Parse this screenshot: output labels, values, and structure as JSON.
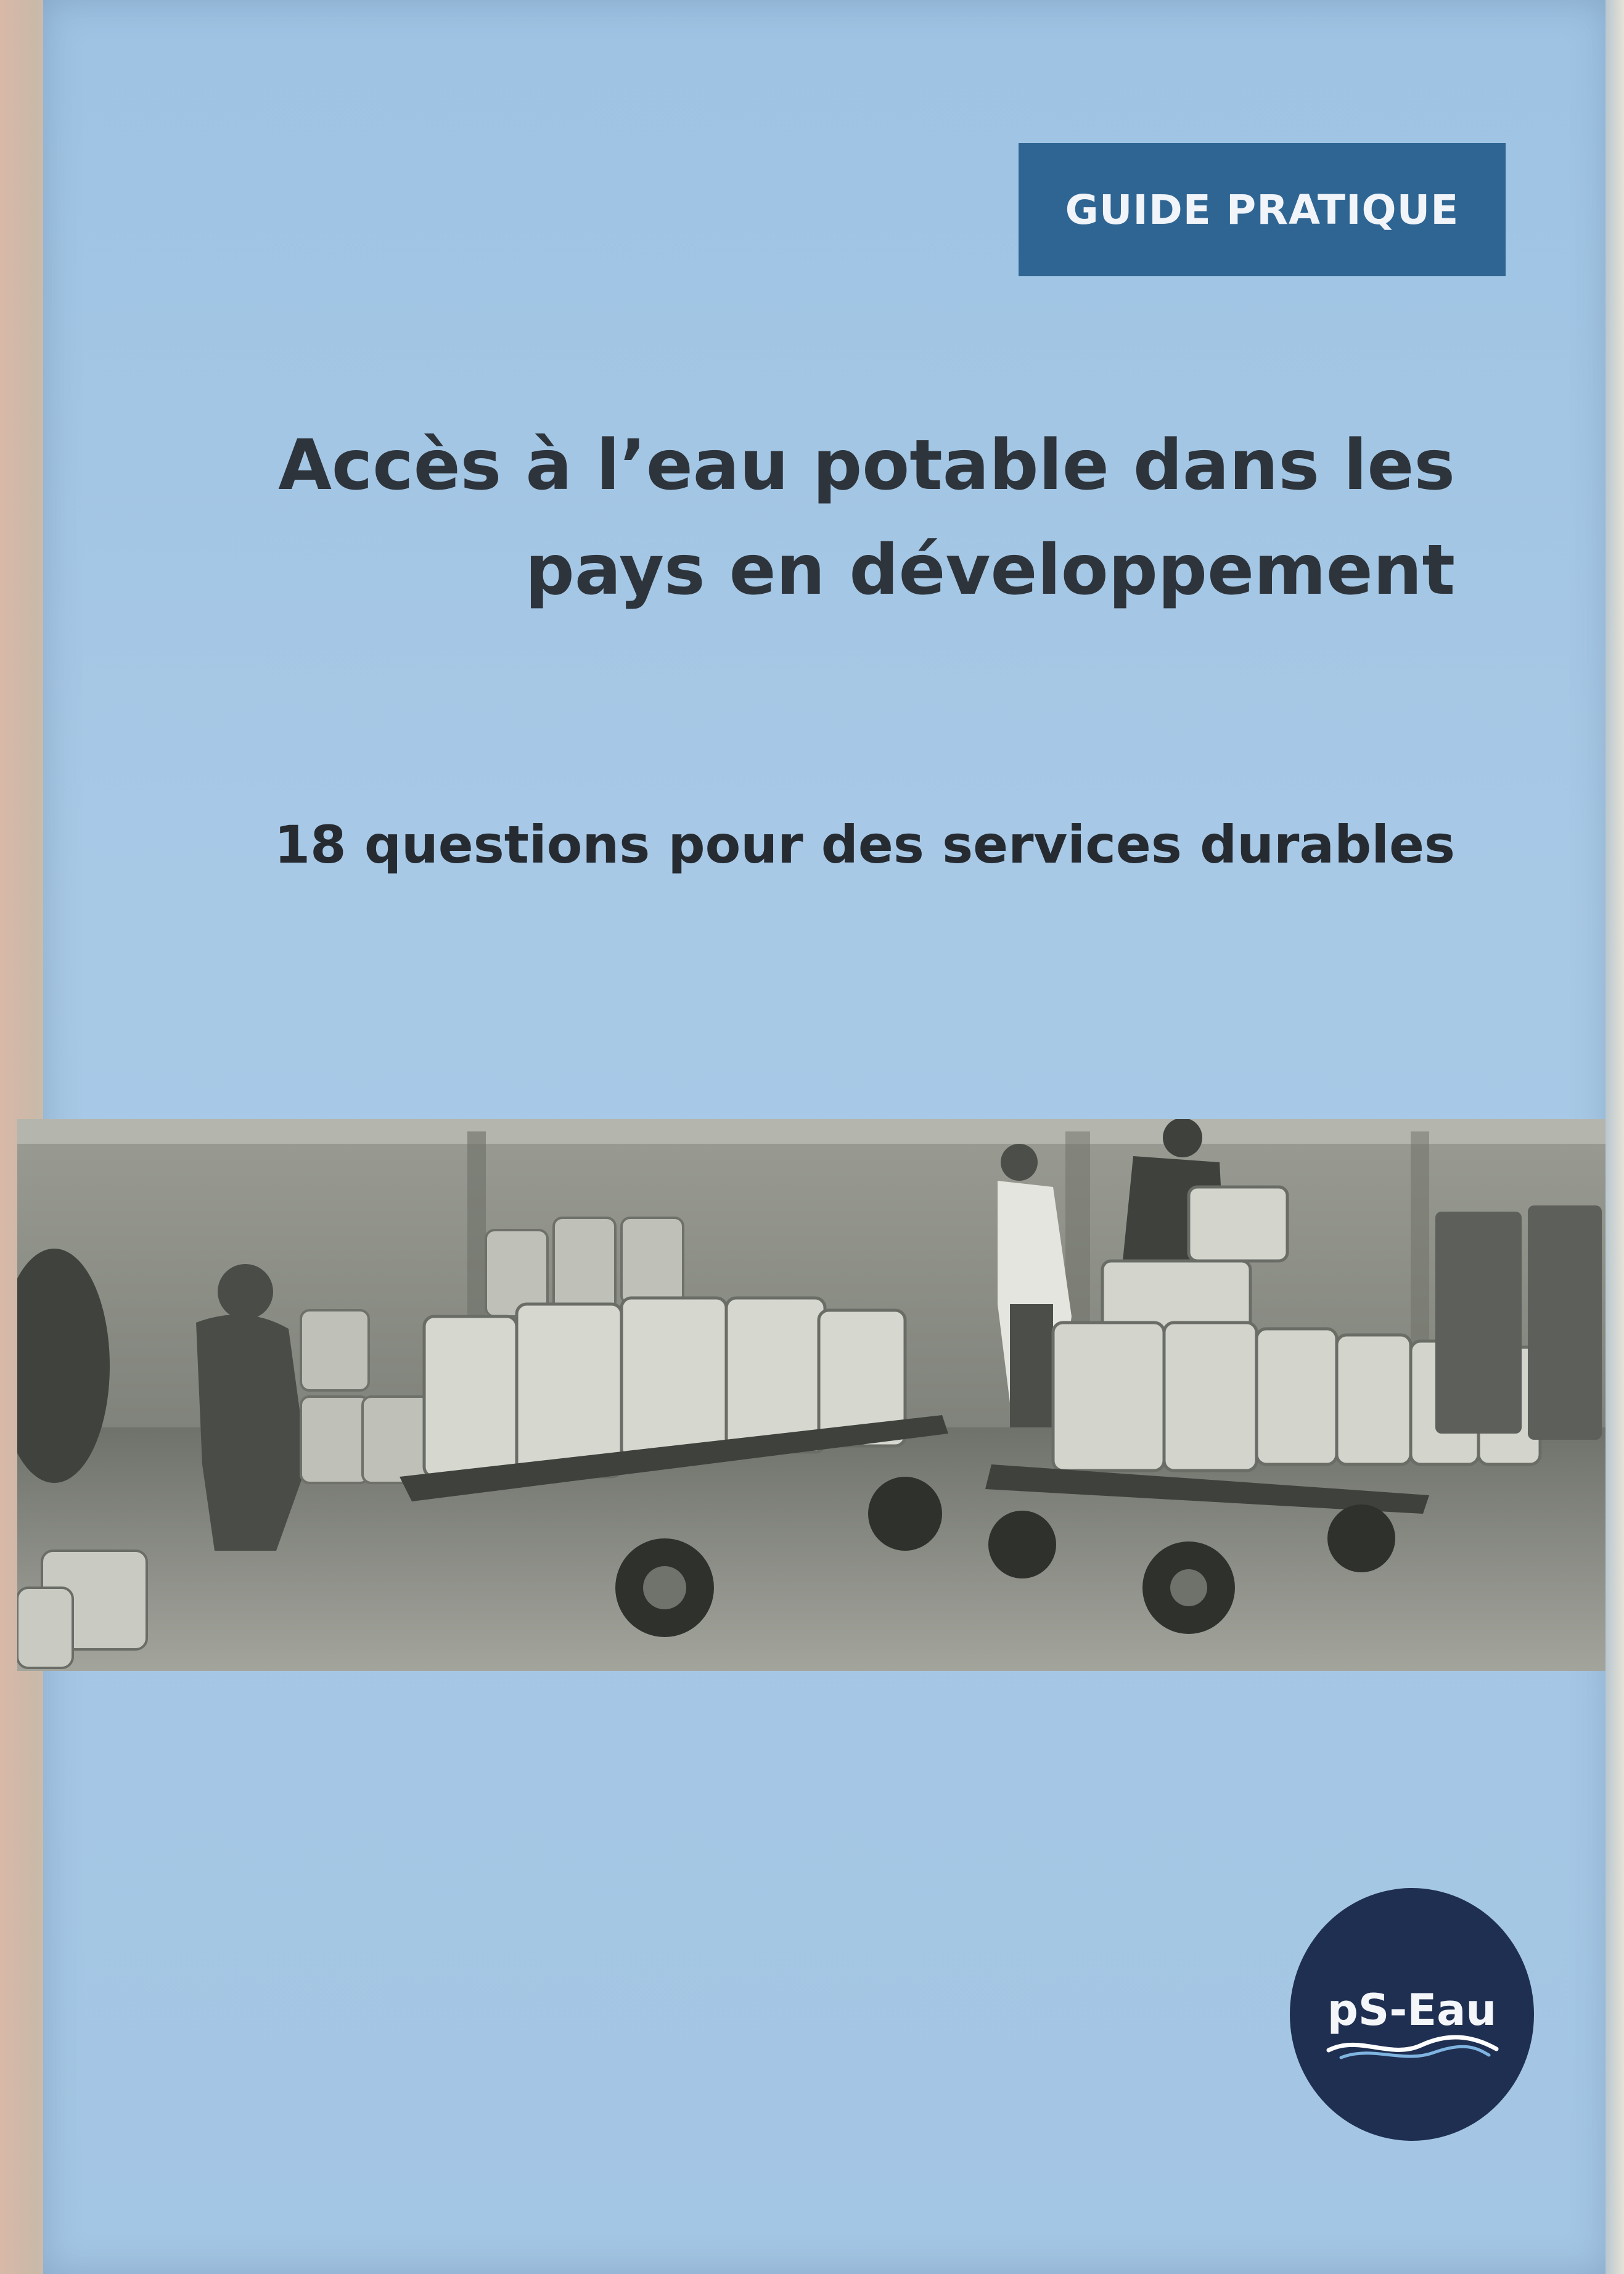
{
  "cover": {
    "badge": "GUIDE PRATIQUE",
    "title_line1": "Accès à l’eau potable dans les",
    "title_line2": "pays en développement",
    "subtitle": "18 questions pour des services durables",
    "logo_text": "pS-Eau"
  },
  "colors": {
    "cover_blue": "#a3c6e4",
    "badge_blue": "#2f6593",
    "logo_navy": "#1f2f52",
    "text_dark": "#2e343b"
  },
  "icons": {
    "logo": "ps-eau-logo-icon",
    "wave": "wave-icon"
  }
}
